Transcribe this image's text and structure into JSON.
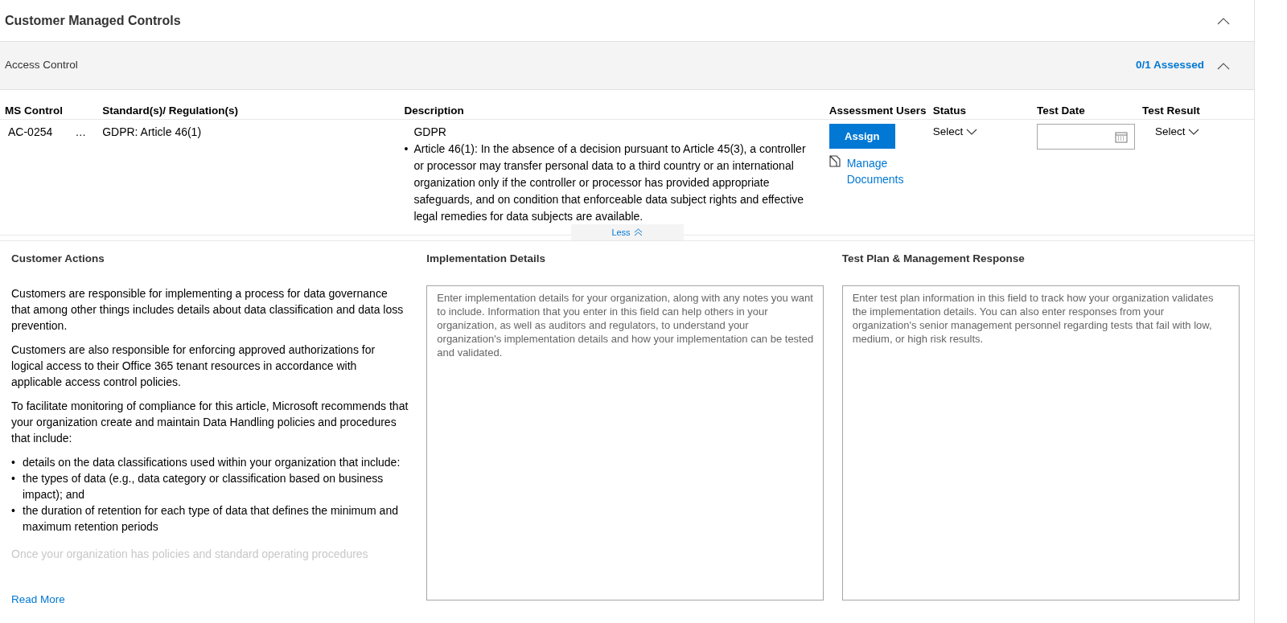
{
  "section": {
    "title": "Customer Managed Controls",
    "expanded": true
  },
  "group": {
    "title": "Access Control",
    "assessed": "0/1 Assessed",
    "expanded": true
  },
  "table": {
    "columns": [
      "MS Control",
      "Standard(s)/ Regulation(s)",
      "Description",
      "Assessment Users",
      "Status",
      "Test Date",
      "Test Result"
    ],
    "rows": [
      {
        "control": "AC-0254",
        "more": "…",
        "standard": "GDPR: Article 46(1)",
        "description_title": "GDPR",
        "bullet_marker": "•",
        "description_bullets": [
          "Article 46(1): In the absence of a decision pursuant to Article 45(3), a controller or processor may transfer personal data to a third country or an international organization only if the controller or processor has provided appropriate safeguards, and on condition that enforceable data subject rights and effective legal remedies for data subjects are available."
        ],
        "assign": "Assign",
        "manage_link": "Manage Documents",
        "status": "Select",
        "result": "Select"
      }
    ]
  },
  "toggle": {
    "label": "Less",
    "expanded": true
  },
  "customer_actions": {
    "title": "Customer Actions",
    "blocks": [
      {
        "kind": "paragraph",
        "text": "Customers are responsible for implementing a process for data governance that among other things includes details about data classification and data loss prevention."
      },
      {
        "kind": "paragraph",
        "text": "Customers are also responsible for enforcing approved authorizations for logical access to their Office 365 tenant resources in accordance with applicable access control policies."
      },
      {
        "kind": "paragraph",
        "text": "To facilitate monitoring of compliance for this article, Microsoft recommends that your organization create and maintain Data Handling policies and procedures that include:"
      },
      {
        "kind": "bullets",
        "marker": "•",
        "items": [
          "details on the data classifications used within your organization that include:",
          "the types of data (e.g., data category or classification based on business impact); and",
          "the duration of retention for each type of data that defines the minimum and maximum retention periods"
        ]
      },
      {
        "kind": "faded",
        "text": "Once your organization has policies and standard operating procedures"
      }
    ],
    "read_more": "Read More"
  },
  "implementation": {
    "title": "Implementation Details",
    "placeholder": "Enter implementation details for your organization, along with any notes you want to include. Information that you enter in this field can help others in your organization, as well as auditors and regulators, to understand your organization's implementation details and how your implementation can be tested and validated."
  },
  "test_plan": {
    "title": "Test Plan & Management Response",
    "placeholder": "Enter test plan information in this field to track how your organization validates the implementation details. You can also enter responses from your organization's senior management personnel regarding tests that fail with low, medium, or high risk results."
  }
}
